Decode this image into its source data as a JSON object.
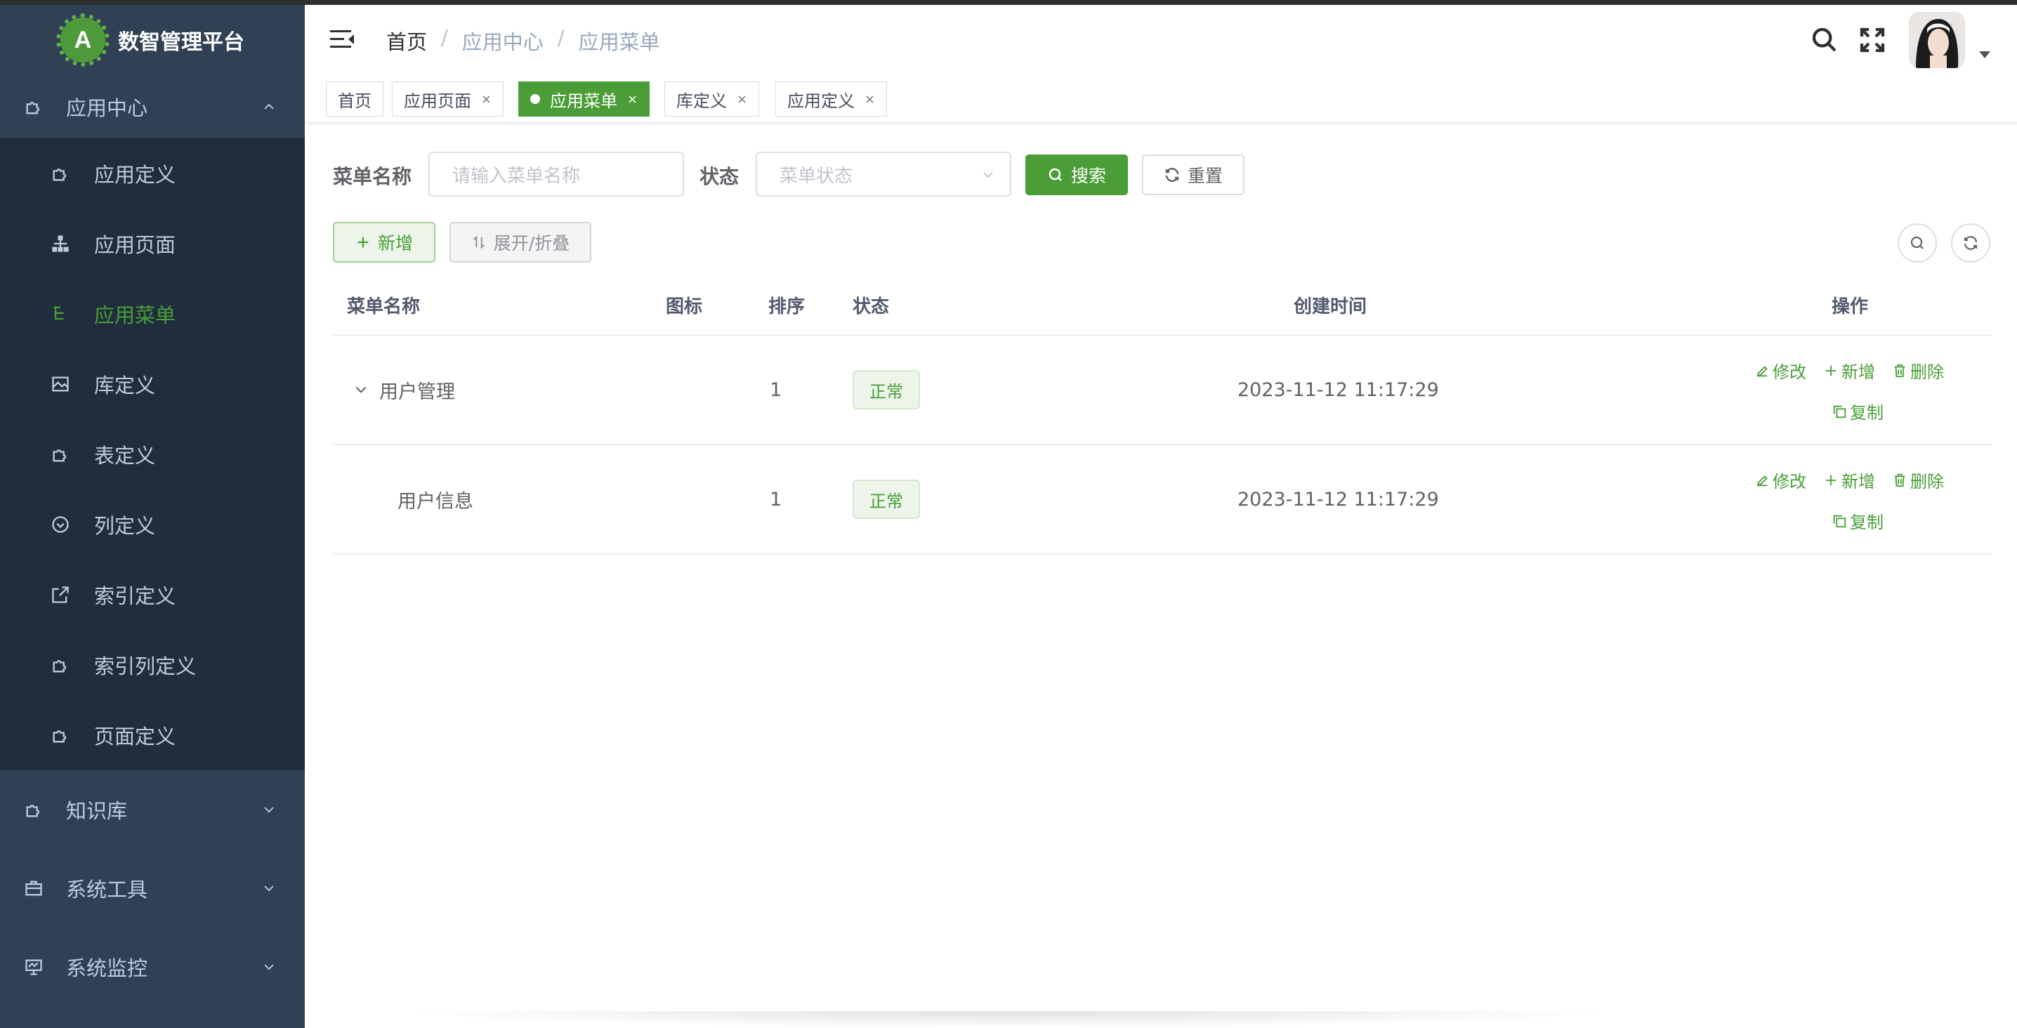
{
  "app": {
    "title": "数智管理平台",
    "logo_letter": "A"
  },
  "sidebar": {
    "open_group": {
      "label": "应用中心",
      "icon": "puzzle-icon"
    },
    "sub_items": [
      {
        "label": "应用定义",
        "icon": "puzzle-icon"
      },
      {
        "label": "应用页面",
        "icon": "tree-structure-icon"
      },
      {
        "label": "应用菜单",
        "icon": "tree-table-icon",
        "active": true
      },
      {
        "label": "库定义",
        "icon": "image-icon"
      },
      {
        "label": "表定义",
        "icon": "puzzle-icon"
      },
      {
        "label": "列定义",
        "icon": "check-circle-icon"
      },
      {
        "label": "索引定义",
        "icon": "external-link-icon"
      },
      {
        "label": "索引列定义",
        "icon": "puzzle-icon"
      },
      {
        "label": "页面定义",
        "icon": "puzzle-icon"
      }
    ],
    "groups": [
      {
        "label": "知识库",
        "icon": "puzzle-icon"
      },
      {
        "label": "系统工具",
        "icon": "toolbox-icon"
      },
      {
        "label": "系统监控",
        "icon": "monitor-icon"
      }
    ]
  },
  "header": {
    "breadcrumb": [
      "首页",
      "应用中心",
      "应用菜单"
    ],
    "separator": "/"
  },
  "tags": [
    {
      "label": "首页",
      "closable": false
    },
    {
      "label": "应用页面",
      "closable": true
    },
    {
      "label": "应用菜单",
      "closable": true,
      "active": true
    },
    {
      "label": "库定义",
      "closable": true
    },
    {
      "label": "应用定义",
      "closable": true
    }
  ],
  "tag_close": "×",
  "search": {
    "menu_name_label": "菜单名称",
    "menu_name_placeholder": "请输入菜单名称",
    "status_label": "状态",
    "status_placeholder": "菜单状态",
    "search_button": "搜索",
    "reset_button": "重置"
  },
  "toolbar": {
    "add_button": "新增",
    "expand_button": "展开/折叠"
  },
  "table": {
    "columns": [
      "菜单名称",
      "图标",
      "排序",
      "状态",
      "创建时间",
      "操作"
    ],
    "rows": [
      {
        "name": "用户管理",
        "icon": "",
        "order": "1",
        "status": "正常",
        "created": "2023-11-12 11:17:29",
        "expandable": true
      },
      {
        "name": "用户信息",
        "icon": "",
        "order": "1",
        "status": "正常",
        "created": "2023-11-12 11:17:29",
        "expandable": false
      }
    ],
    "actions": {
      "edit": "修改",
      "add": "新增",
      "delete": "删除",
      "copy": "复制"
    }
  },
  "colors": {
    "primary": "#4a9d37",
    "sidebar_bg": "#304156",
    "submenu_bg": "#1f2d3d"
  }
}
